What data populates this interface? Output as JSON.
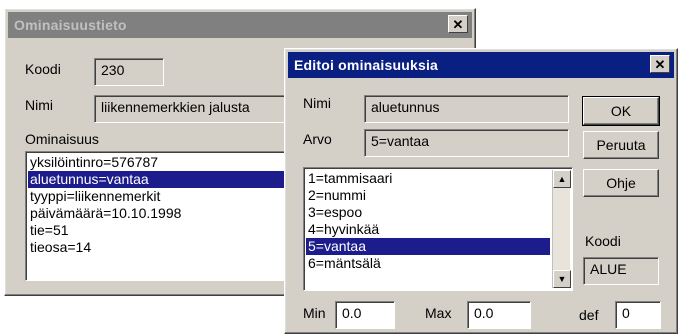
{
  "back_window": {
    "title": "Ominaisuustieto",
    "close_label": "✕",
    "koodi_label": "Koodi",
    "koodi_value": "230",
    "nimi_label": "Nimi",
    "nimi_value": "liikennemerkkien jalusta",
    "ominaisuus_label": "Ominaisuus",
    "items": [
      "yksilöintinro=576787",
      "aluetunnus=vantaa",
      "tyyppi=liikennemerkit",
      "päivämäärä=10.10.1998",
      "tie=51",
      "tieosa=14"
    ],
    "selected_index": 1
  },
  "front_window": {
    "title": "Editoi ominaisuuksia",
    "close_label": "✕",
    "nimi_label": "Nimi",
    "nimi_value": "aluetunnus",
    "arvo_label": "Arvo",
    "arvo_value": "5=vantaa",
    "options": [
      "1=tammisaari",
      "2=nummi",
      "3=espoo",
      "4=hyvinkää",
      "5=vantaa",
      "6=mäntsälä"
    ],
    "selected_index": 4,
    "ok_label": "OK",
    "cancel_label": "Peruuta",
    "help_label": "Ohje",
    "koodi_label": "Koodi",
    "koodi_value": "ALUE",
    "min_label": "Min",
    "min_value": "0.0",
    "max_label": "Max",
    "max_value": "0.0",
    "def_label": "def",
    "def_value": "0"
  },
  "colors": {
    "active_title": "#0a1f82",
    "inactive_title": "#808080",
    "selection": "#1c1c8c",
    "face": "#d4d0c8"
  }
}
